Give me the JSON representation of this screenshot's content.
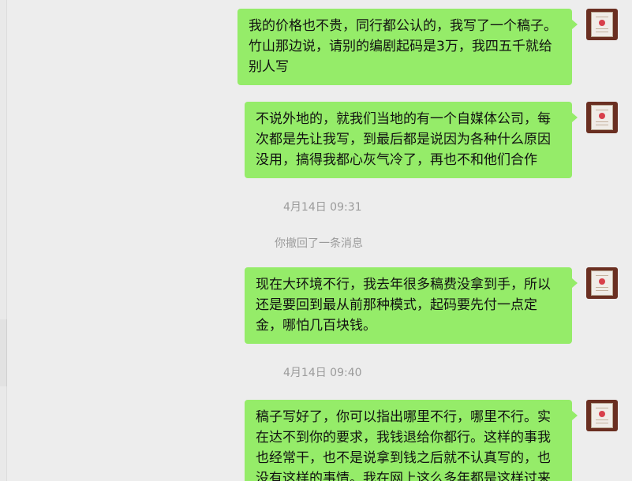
{
  "messages": [
    {
      "text": "我的价格也不贵，同行都公认的，我写了一个稿子。竹山那边说，请别的编剧起码是3万，我四五千就给别人写"
    },
    {
      "text": "不说外地的，就我们当地的有一个自媒体公司，每次都是先让我写，到最后都是说因为各种什么原因没用，搞得我都心灰气冷了，再也不和他们合作"
    },
    {
      "text": "现在大环境不行，我去年很多稿费没拿到手，所以还是要回到最从前那种模式，起码要先付一点定金，哪怕几百块钱。"
    },
    {
      "text": "稿子写好了，你可以指出哪里不行，哪里不行。实在达不到你的要求，我钱退给你都行。这样的事我也经常干，也不是说拿到钱之后就不认真写的，也没有这样的事情。我在网上这么多年都是这样过来"
    }
  ],
  "timestamps": [
    "4月14日 09:31",
    "4月14日 09:40"
  ],
  "notice": "你撤回了一条消息",
  "colors": {
    "background": "#ededed",
    "bubble": "#95ec69",
    "text": "#111111",
    "meta": "#9b9b9b"
  },
  "icons": {
    "avatar": "avatar-icon"
  }
}
